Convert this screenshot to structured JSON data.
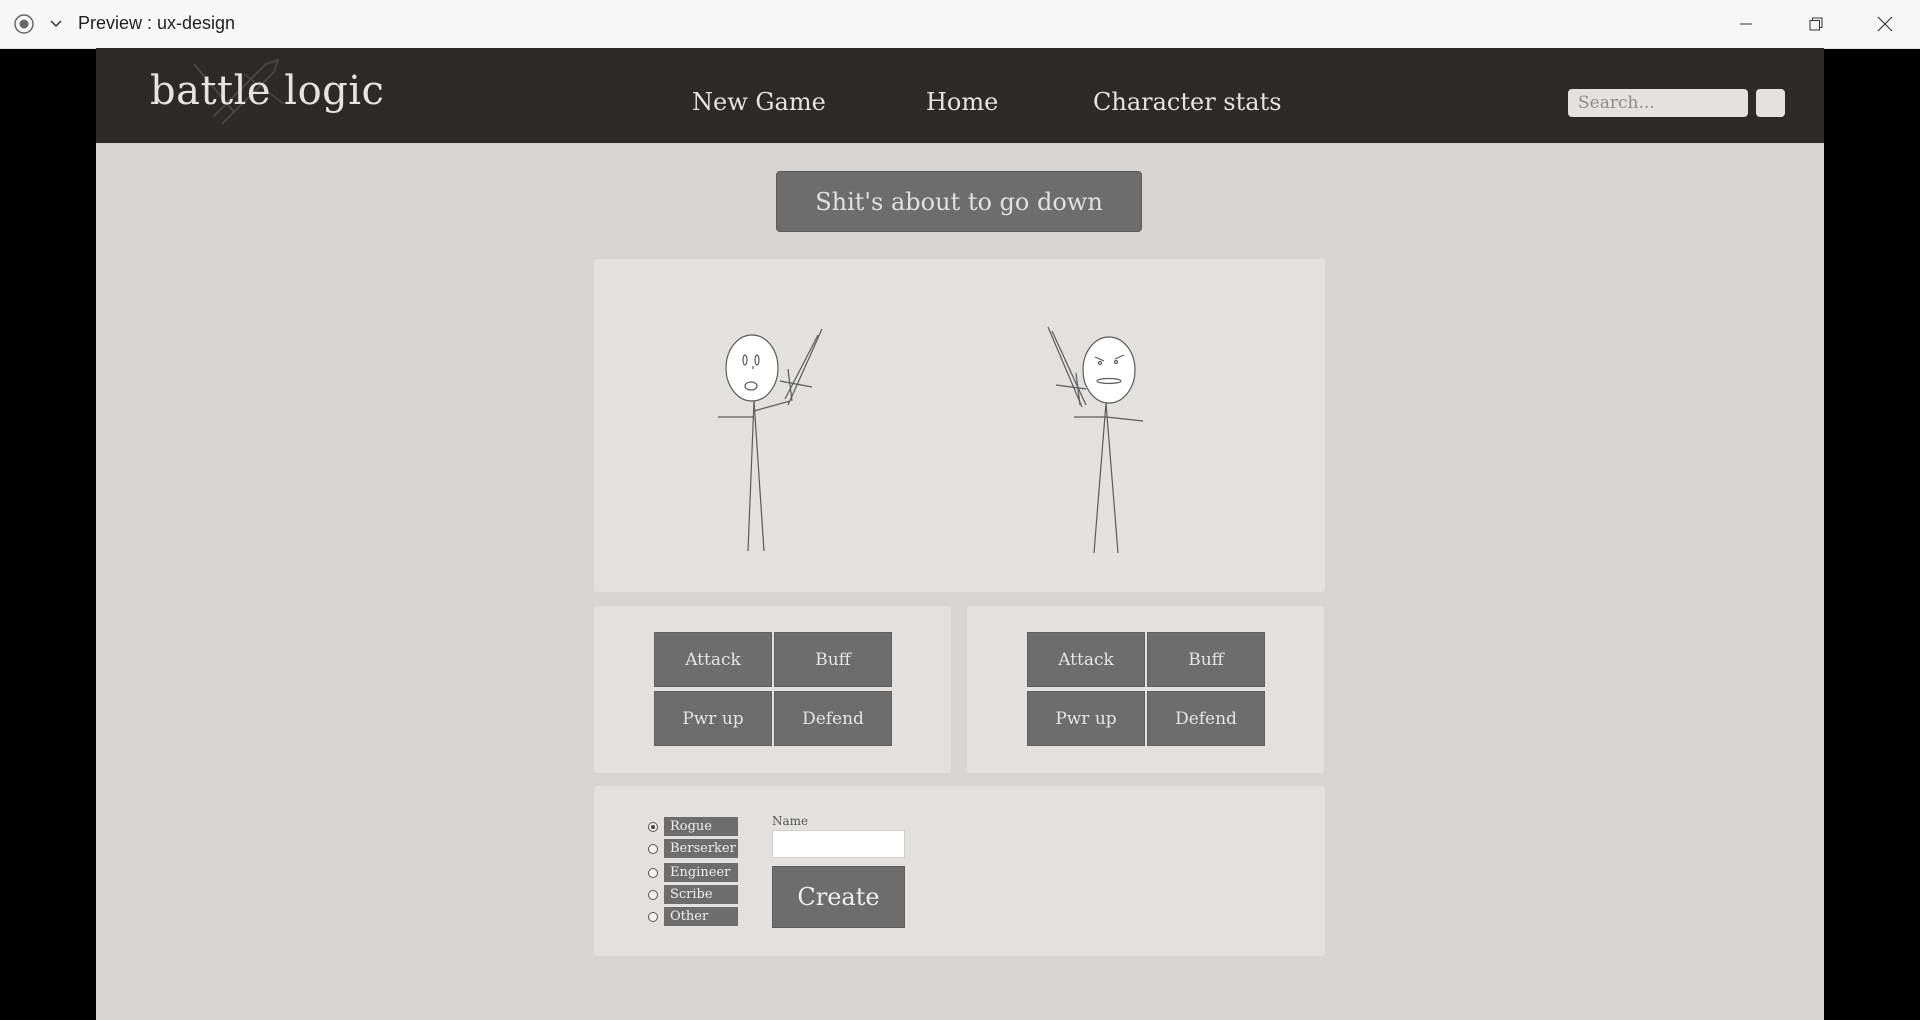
{
  "window": {
    "title": "Preview : ux-design"
  },
  "navbar": {
    "logo": "battle logic",
    "links": [
      "New Game",
      "Home",
      "Character stats"
    ],
    "search_placeholder": "Search..."
  },
  "banner": {
    "text": "Shit's about to go down"
  },
  "arena": {
    "fighters": [
      "left-stick-fighter",
      "right-stick-fighter"
    ]
  },
  "action_panels": [
    {
      "buttons": [
        "Attack",
        "Buff",
        "Pwr up",
        "Defend"
      ]
    },
    {
      "buttons": [
        "Attack",
        "Buff",
        "Pwr up",
        "Defend"
      ]
    }
  ],
  "create_character": {
    "classes": [
      "Rogue",
      "Berserker",
      "Engineer",
      "Scribe",
      "Other"
    ],
    "selected_class": "Rogue",
    "name_label": "Name",
    "name_value": "",
    "create_label": "Create"
  },
  "colors": {
    "navbar_bg": "#2d2a29",
    "page_bg": "#d7d5d4",
    "panel_bg": "#e2e1e0",
    "button_bg": "#6d6d6d"
  }
}
